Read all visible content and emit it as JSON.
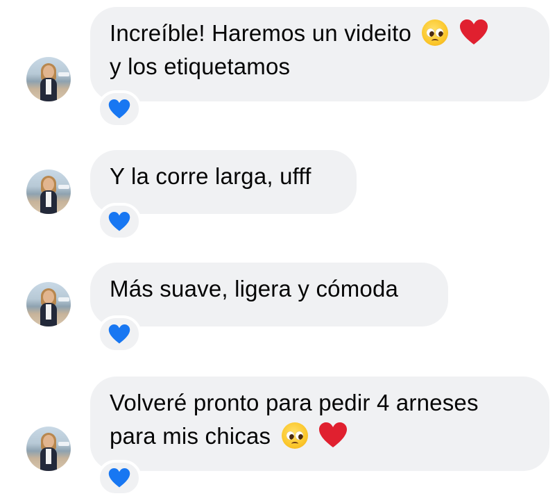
{
  "thread": {
    "messages": [
      {
        "lines": [
          "Increíble! Haremos un videito",
          "y los etiquetamos"
        ],
        "line_emojis": [
          [
            "pleading-face-icon",
            "red-heart-icon"
          ],
          []
        ],
        "reaction": "blue-heart-icon"
      },
      {
        "lines": [
          "Y la corre larga, ufff"
        ],
        "line_emojis": [
          []
        ],
        "reaction": "blue-heart-icon"
      },
      {
        "lines": [
          "Más suave, ligera y cómoda"
        ],
        "line_emojis": [
          []
        ],
        "reaction": "blue-heart-icon"
      },
      {
        "lines": [
          "Volveré pronto para pedir 4 arneses",
          "para mis chicas"
        ],
        "line_emojis": [
          [],
          [
            "pleading-face-icon",
            "red-heart-icon"
          ]
        ],
        "reaction": "blue-heart-icon"
      }
    ]
  },
  "colors": {
    "bubble_bg": "#f0f1f3",
    "text": "#050505",
    "red_heart": "#e0202f",
    "blue_heart": "#1877f2"
  }
}
